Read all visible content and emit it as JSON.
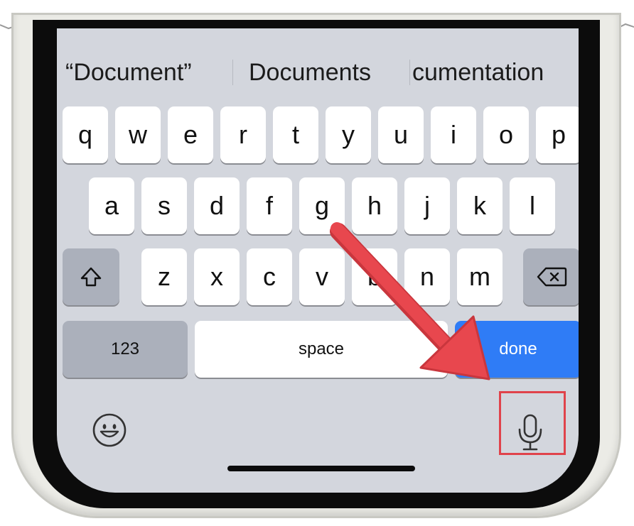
{
  "suggestions": [
    "“Document”",
    "Documents",
    "cumentation"
  ],
  "rows": {
    "row1": [
      "q",
      "w",
      "e",
      "r",
      "t",
      "y",
      "u",
      "i",
      "o",
      "p"
    ],
    "row2": [
      "a",
      "s",
      "d",
      "f",
      "g",
      "h",
      "j",
      "k",
      "l"
    ],
    "row3": [
      "z",
      "x",
      "c",
      "v",
      "b",
      "n",
      "m"
    ]
  },
  "bottom": {
    "numbers_label": "123",
    "space_label": "space",
    "done_label": "done"
  },
  "icons": {
    "shift": "shift-icon",
    "delete": "delete-icon",
    "emoji": "emoji-icon",
    "dictation": "microphone-icon"
  },
  "colors": {
    "done_key": "#2f7cf6",
    "annotation_arrow": "#e0434b",
    "keyboard_bg": "#d3d6dd"
  }
}
